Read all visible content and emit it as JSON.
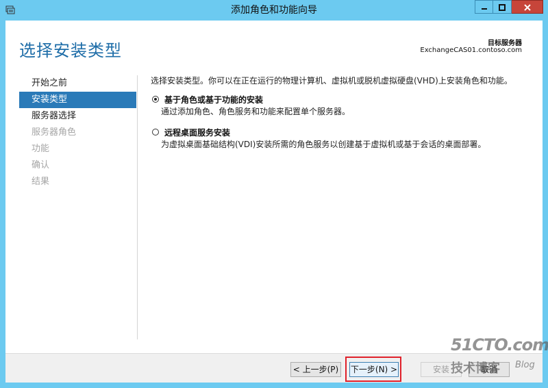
{
  "window": {
    "title": "添加角色和功能向导",
    "controls": [
      "minimize",
      "maximize",
      "close"
    ]
  },
  "header": {
    "page_title": "选择安装类型",
    "destination_label": "目标服务器",
    "destination_value": "ExchangeCAS01.contoso.com"
  },
  "nav": {
    "items": [
      {
        "label": "开始之前",
        "state": "normal"
      },
      {
        "label": "安装类型",
        "state": "active"
      },
      {
        "label": "服务器选择",
        "state": "normal"
      },
      {
        "label": "服务器角色",
        "state": "disabled"
      },
      {
        "label": "功能",
        "state": "disabled"
      },
      {
        "label": "确认",
        "state": "disabled"
      },
      {
        "label": "结果",
        "state": "disabled"
      }
    ]
  },
  "main": {
    "intro": "选择安装类型。你可以在正在运行的物理计算机、虚拟机或脱机虚拟硬盘(VHD)上安装角色和功能。",
    "options": [
      {
        "title": "基于角色或基于功能的安装",
        "description": "通过添加角色、角色服务和功能来配置单个服务器。",
        "selected": true
      },
      {
        "title": "远程桌面服务安装",
        "description": "为虚拟桌面基础结构(VDI)安装所需的角色服务以创建基于虚拟机或基于会话的桌面部署。",
        "selected": false
      }
    ]
  },
  "footer": {
    "back_label": "< 上一步(P)",
    "next_label": "下一步(N) >",
    "install_label": "安装",
    "cancel_label": "取消"
  },
  "watermark": {
    "main": "51CTO.com",
    "sub": "技术博客",
    "blog": "Blog"
  },
  "colors": {
    "titlebar": "#6ccaf0",
    "accent": "#2a7ab8",
    "page_title": "#1e6da8",
    "close_button": "#c7453a",
    "highlight": "#e0202a"
  }
}
